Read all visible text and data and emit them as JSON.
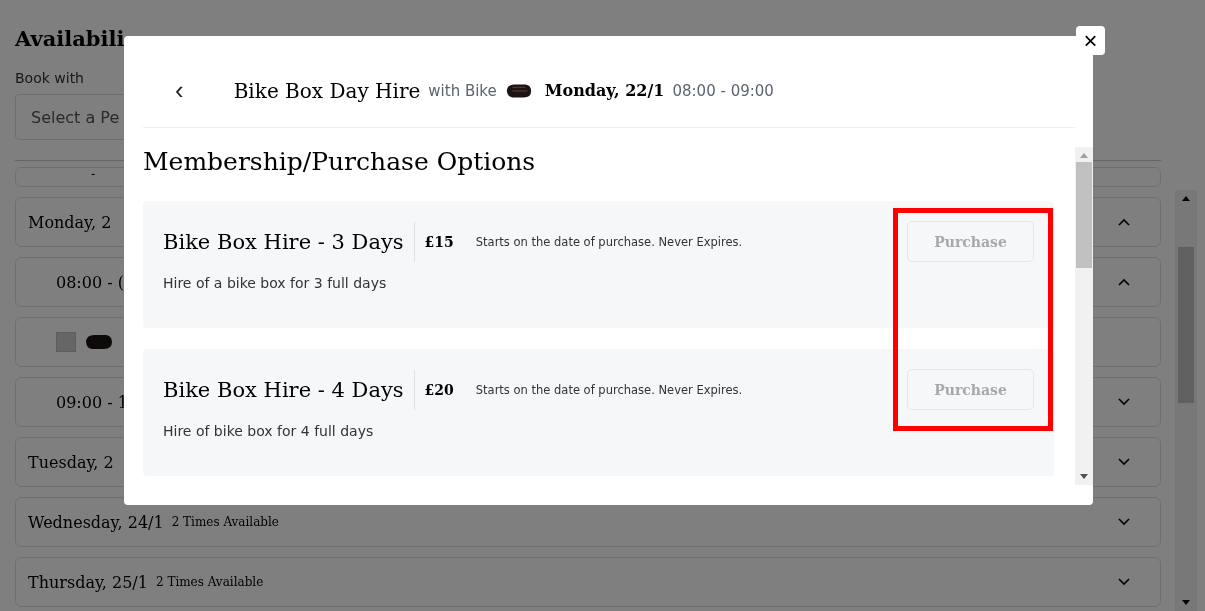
{
  "page": {
    "heading": "Availabili",
    "book_with_label": "Book with",
    "select": {
      "placeholder": "Select a Pe"
    },
    "rows": [
      {
        "kind": "partial",
        "label": "-"
      },
      {
        "kind": "day",
        "label": "Monday, 2",
        "expanded": true
      },
      {
        "kind": "time",
        "label": "08:00 - (",
        "expanded": true
      },
      {
        "kind": "item",
        "checked": false
      },
      {
        "kind": "time",
        "label": "09:00 - 1",
        "expanded": false
      },
      {
        "kind": "day",
        "label": "Tuesday, 2",
        "expanded": false
      },
      {
        "kind": "day",
        "label": "Wednesday, 24/1",
        "count": "2 Times Available",
        "expanded": false
      },
      {
        "kind": "day",
        "label": "Thursday, 25/1",
        "count": "2 Times Available",
        "expanded": false
      }
    ]
  },
  "modal": {
    "back": "‹",
    "title": "Bike Box Day Hire",
    "with_label": "with Bike",
    "date": "Monday, 22/1",
    "time": "08:00 - 09:00",
    "close": "×",
    "section_title": "Membership/Purchase Options",
    "highlight_box": true,
    "options": [
      {
        "name": "Bike Box Hire - 3 Days",
        "price": "£15",
        "terms": "Starts on the date of purchase. Never Expires.",
        "description": "Hire of a bike box for 3 full days",
        "button": {
          "label": "Purchase",
          "disabled": true
        }
      },
      {
        "name": "Bike Box Hire - 4 Days",
        "price": "£20",
        "terms": "Starts on the date of purchase. Never Expires.",
        "description": "Hire of bike box for 4 full days",
        "button": {
          "label": "Purchase",
          "disabled": true
        }
      }
    ]
  }
}
